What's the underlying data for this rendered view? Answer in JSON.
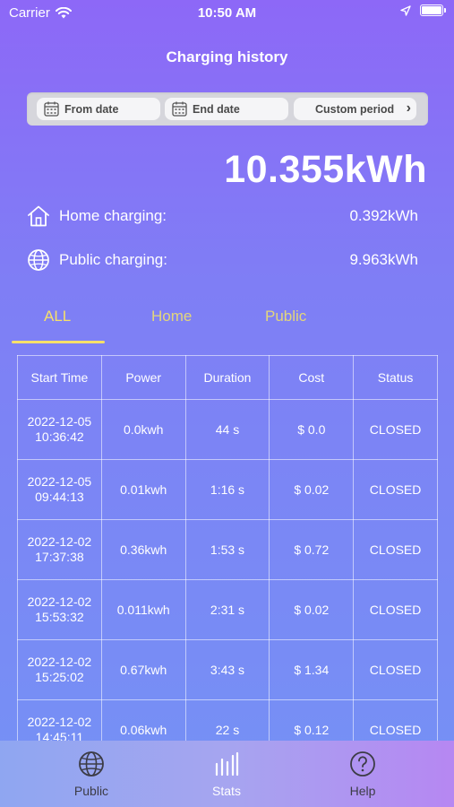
{
  "status_bar": {
    "carrier": "Carrier",
    "time": "10:50 AM"
  },
  "title": "Charging history",
  "filters": {
    "from_label": "From date",
    "end_label": "End date",
    "custom_label": "Custom period"
  },
  "summary": {
    "total": "10.355kWh",
    "home_label": "Home charging:",
    "home_value": "0.392kWh",
    "public_label": "Public charging:",
    "public_value": "9.963kWh"
  },
  "tabs": {
    "all": "ALL",
    "home": "Home",
    "public": "Public"
  },
  "table": {
    "headers": [
      "Start Time",
      "Power",
      "Duration",
      "Cost",
      "Status"
    ],
    "rows": [
      {
        "date": "2022-12-05",
        "time": "10:36:42",
        "power": "0.0kwh",
        "duration": "44 s",
        "cost": "$ 0.0",
        "status": "CLOSED"
      },
      {
        "date": "2022-12-05",
        "time": "09:44:13",
        "power": "0.01kwh",
        "duration": "1:16 s",
        "cost": "$ 0.02",
        "status": "CLOSED"
      },
      {
        "date": "2022-12-02",
        "time": "17:37:38",
        "power": "0.36kwh",
        "duration": "1:53 s",
        "cost": "$ 0.72",
        "status": "CLOSED"
      },
      {
        "date": "2022-12-02",
        "time": "15:53:32",
        "power": "0.011kwh",
        "duration": "2:31 s",
        "cost": "$ 0.02",
        "status": "CLOSED"
      },
      {
        "date": "2022-12-02",
        "time": "15:25:02",
        "power": "0.67kwh",
        "duration": "3:43 s",
        "cost": "$ 1.34",
        "status": "CLOSED"
      },
      {
        "date": "2022-12-02",
        "time": "14:45:11",
        "power": "0.06kwh",
        "duration": "22 s",
        "cost": "$ 0.12",
        "status": "CLOSED"
      }
    ]
  },
  "nav": {
    "public": "Public",
    "stats": "Stats",
    "help": "Help"
  },
  "icons": {
    "from": "calendar-icon",
    "end": "calendar-icon",
    "custom": "chevron-right-icon",
    "home": "home-icon",
    "public": "globe-icon",
    "stats": "bar-chart-icon",
    "help": "question-icon"
  },
  "colors": {
    "accent_tab": "#f6e06a",
    "background_top": "#8d68f7",
    "background_bottom": "#7592f5"
  }
}
